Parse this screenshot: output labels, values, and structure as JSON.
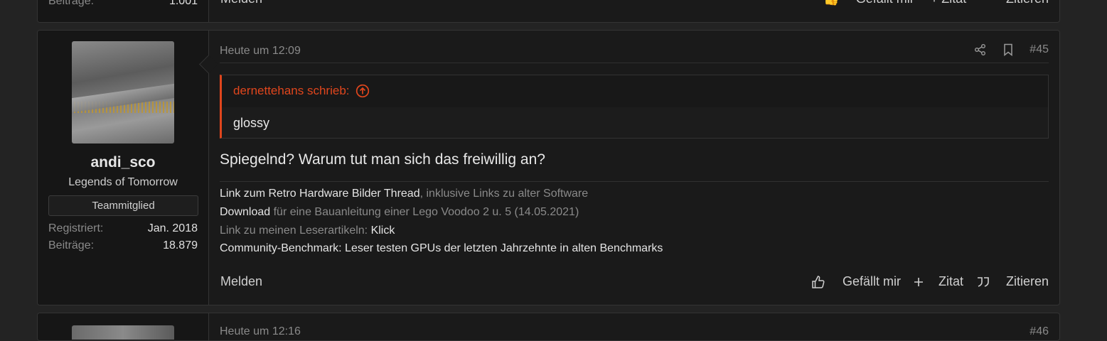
{
  "prev_post": {
    "stat_label": "Beiträge:",
    "stat_value": "1.001",
    "report": "Melden",
    "like": "Gefällt mir",
    "plus_quote": "+ Zitat",
    "quote": "Zitieren"
  },
  "post": {
    "username": "andi_sco",
    "user_title": "Legends of Tomorrow",
    "badge": "Teammitglied",
    "registered_label": "Registriert:",
    "registered_value": "Jan. 2018",
    "posts_label": "Beiträge:",
    "posts_value": "18.879",
    "date": "Heute um 12:09",
    "number": "#45",
    "quote_author": "dernettehans schrieb:",
    "quote_text": "glossy",
    "message": "Spiegelnd? Warum tut man sich das freiwillig an?",
    "signature": [
      {
        "link": "Link zum Retro Hardware Bilder Thread",
        "text": ", inklusive Links zu alter Software"
      },
      {
        "link": "Download",
        "text": " für eine Bauanleitung einer Lego Voodoo 2 u. 5 (14.05.2021)"
      },
      {
        "text_first": "Link zu meinen Leserartikeln: ",
        "link": "Klick"
      },
      {
        "link": "Community-Benchmark: Leser testen GPUs der letzten Jahrzehnte in alten Benchmarks"
      }
    ],
    "report": "Melden",
    "like": "Gefällt mir",
    "plus_quote": "Zitat",
    "quote": "Zitieren"
  },
  "next_post": {
    "date": "Heute um 12:16",
    "number": "#46"
  },
  "colors": {
    "accent": "#e0461d",
    "background": "#232323",
    "panel": "#1a1a1a"
  }
}
